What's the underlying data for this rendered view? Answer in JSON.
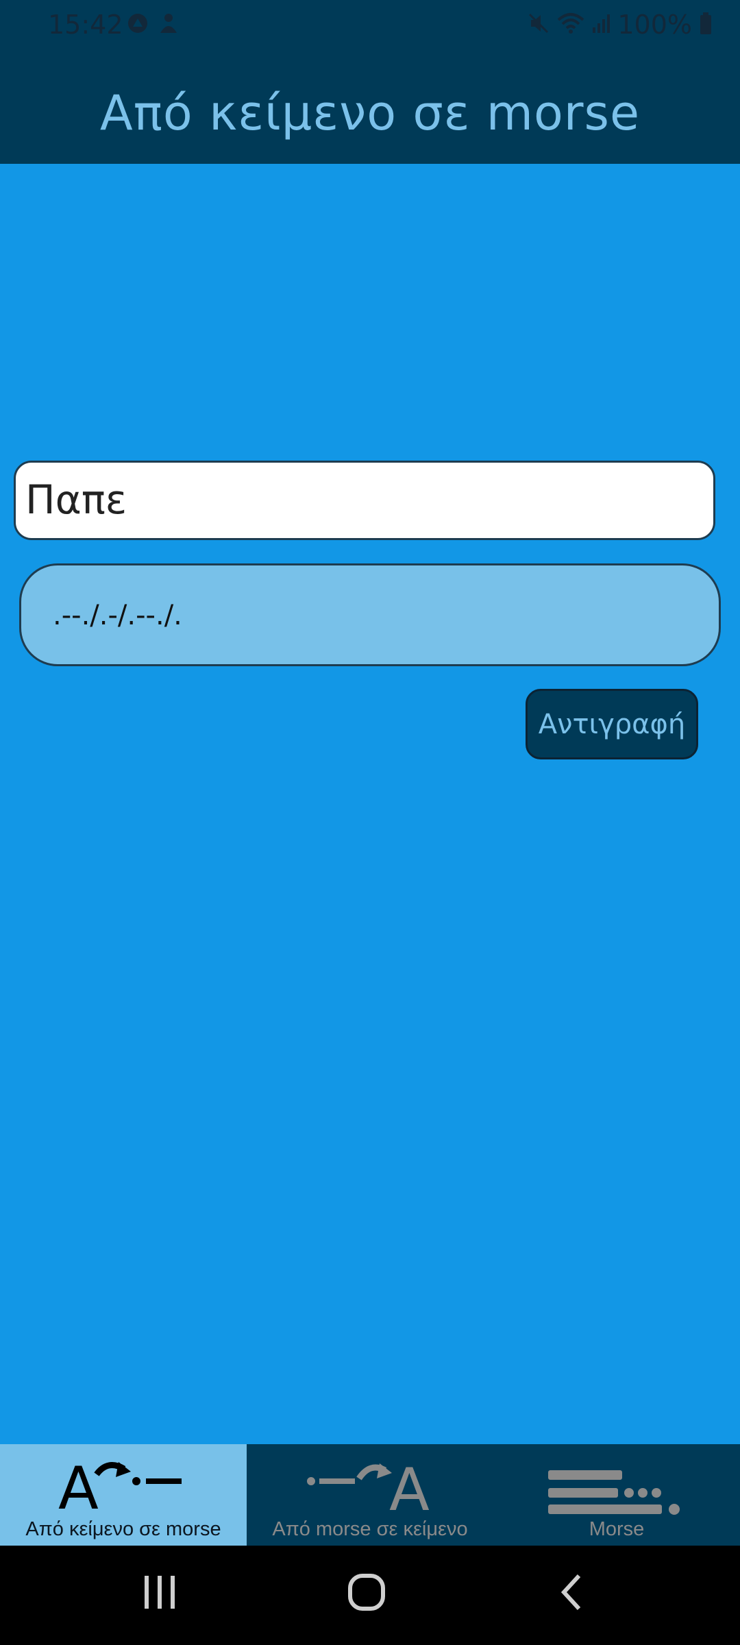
{
  "status_bar": {
    "time": "15:42",
    "battery": "100%"
  },
  "app_bar": {
    "title": "Από κείμενο σε morse"
  },
  "input": {
    "value": "Παπε"
  },
  "output": {
    "morse": ".--./.-/.--./."
  },
  "copy_button": {
    "label": "Αντιγραφή"
  },
  "bottom_nav": {
    "items": [
      {
        "label": "Από κείμενο σε morse",
        "icon": "text-to-morse-icon",
        "active": true
      },
      {
        "label": "Από morse σε κείμενο",
        "icon": "morse-to-text-icon",
        "active": false
      },
      {
        "label": "Morse",
        "icon": "morse-chart-icon",
        "active": false
      }
    ]
  },
  "colors": {
    "background": "#1297e6",
    "bar": "#003a57",
    "accent_text": "#7bc1ea",
    "output_fill": "#78c1e9"
  }
}
